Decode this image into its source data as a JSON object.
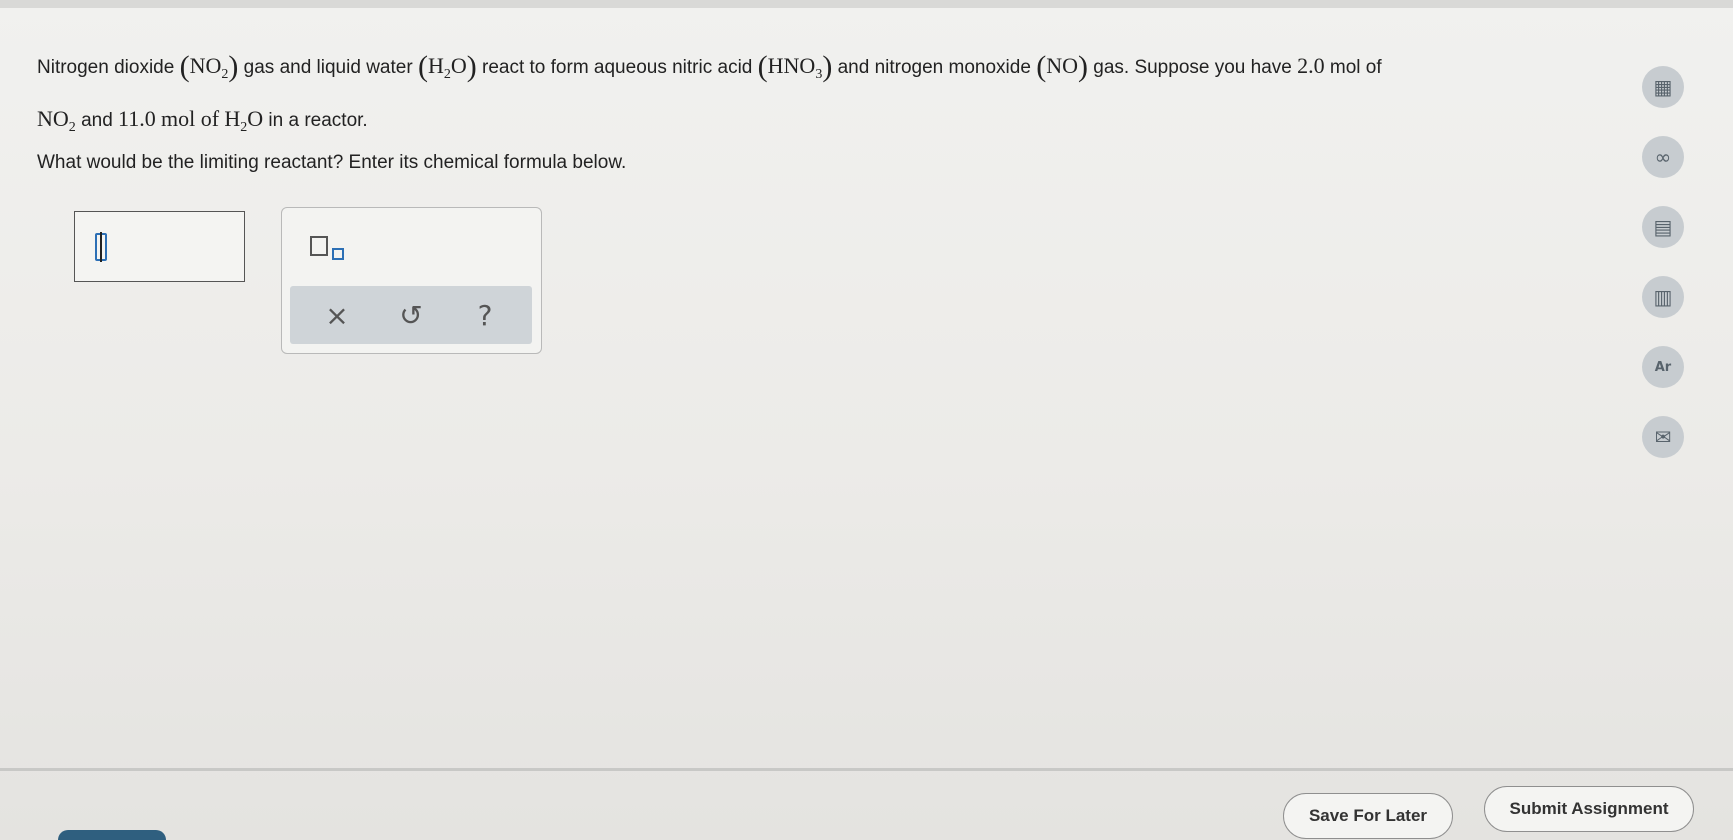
{
  "question": {
    "t1": "Nitrogen dioxide",
    "no2_main": "NO",
    "no2_sub": "2",
    "t2": "gas and liquid water",
    "h2o_h": "H",
    "h2o_sub": "2",
    "h2o_o": "O",
    "t3": "react to form aqueous nitric acid",
    "hno3_main": "HNO",
    "hno3_sub": "3",
    "t4": "and nitrogen monoxide",
    "no_main": "NO",
    "t5": "gas. Suppose you have",
    "amount1": "2.0",
    "t6": "mol of",
    "no2b_main": "NO",
    "no2b_sub": "2",
    "t7": "and",
    "amount2": "11.0",
    "t8": "mol of",
    "h2ob_h": "H",
    "h2ob_sub": "2",
    "h2ob_o": "O",
    "t9": "in a reactor."
  },
  "prompt": "What would be the limiting reactant? Enter its chemical formula below.",
  "toolbox": {
    "clear_symbol": "×",
    "undo_symbol": "↺",
    "help_symbol": "?"
  },
  "sidebar": {
    "calculator_icon": "▦",
    "ratio_icon": "∞",
    "book_icon": "▤",
    "chart_icon": "▥",
    "periodic_table_label": "Ar",
    "mail_icon": "✉"
  },
  "footer": {
    "save_label": "Save For Later",
    "submit_label": "Submit Assignment"
  }
}
